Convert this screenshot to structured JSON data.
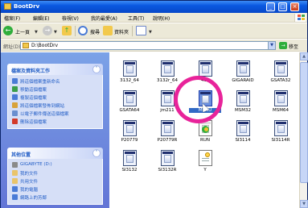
{
  "window": {
    "title": "BootDrv",
    "buttons": [
      "_",
      "□",
      "×"
    ]
  },
  "menu": [
    "檔案(F)",
    "編輯(E)",
    "檢視(V)",
    "我的最愛(A)",
    "工具(T)",
    "說明(H)"
  ],
  "toolbar": {
    "back_label": "上一頁",
    "search_label": "搜尋",
    "folders_label": "資料夾"
  },
  "address": {
    "label": "網址(D)",
    "path": "D:\\BootDrv",
    "go_label": "移至"
  },
  "tasks_panel": {
    "title": "檔案及資料夾工作",
    "items": [
      {
        "label": "將這個檔案重新命名",
        "icon": "rename-icon",
        "color": "#4a7bd6"
      },
      {
        "label": "移動這個檔案",
        "icon": "move-icon",
        "color": "#3a9e4a"
      },
      {
        "label": "複製這個檔案",
        "icon": "copy-icon",
        "color": "#4a7bd6"
      },
      {
        "label": "將這個檔案發佈到網站",
        "icon": "publish-icon",
        "color": "#d8a23a"
      },
      {
        "label": "以電子郵件傳送這個檔案",
        "icon": "email-icon",
        "color": "#6a8fd0"
      },
      {
        "label": "刪除這個檔案",
        "icon": "delete-icon",
        "color": "#d33a2a"
      }
    ]
  },
  "places_panel": {
    "title": "其他位置",
    "items": [
      {
        "label": "GIGABYTE (D:)",
        "icon": "drive-icon",
        "color": "#8a8a8a"
      },
      {
        "label": "我的文件",
        "icon": "documents-icon",
        "color": "#e9c46a"
      },
      {
        "label": "共用文件",
        "icon": "shared-documents-icon",
        "color": "#e9c46a"
      },
      {
        "label": "我的電腦",
        "icon": "computer-icon",
        "color": "#4a7bd6"
      },
      {
        "label": "網路上的芳鄰",
        "icon": "network-icon",
        "color": "#4a7bd6"
      }
    ]
  },
  "files": [
    {
      "label": "3132_64",
      "kind": "folder"
    },
    {
      "label": "3132r_64",
      "kind": "folder"
    },
    {
      "label": "4ch",
      "kind": "folder"
    },
    {
      "label": "GIGARAID",
      "kind": "folder"
    },
    {
      "label": "GSATA32",
      "kind": "folder"
    },
    {
      "label": "GSATA64",
      "kind": "folder"
    },
    {
      "label": "jm211",
      "kind": "folder"
    },
    {
      "label": "MENU",
      "kind": "folder",
      "selected": true
    },
    {
      "label": "MSM32",
      "kind": "folder"
    },
    {
      "label": "MSM64",
      "kind": "folder"
    },
    {
      "label": "P20779",
      "kind": "folder"
    },
    {
      "label": "P20779R",
      "kind": "folder"
    },
    {
      "label": "RUN",
      "kind": "exe"
    },
    {
      "label": "SI3114",
      "kind": "folder"
    },
    {
      "label": "SI3114R",
      "kind": "folder"
    },
    {
      "label": "SI3132",
      "kind": "folder"
    },
    {
      "label": "SI3132R",
      "kind": "folder"
    },
    {
      "label": "Y",
      "kind": "doc"
    }
  ],
  "colors": {
    "titlebar": "#0a58e0",
    "taskpane": "#7ba2e7",
    "highlight": "#e8239a",
    "selection": "#316ac5"
  }
}
